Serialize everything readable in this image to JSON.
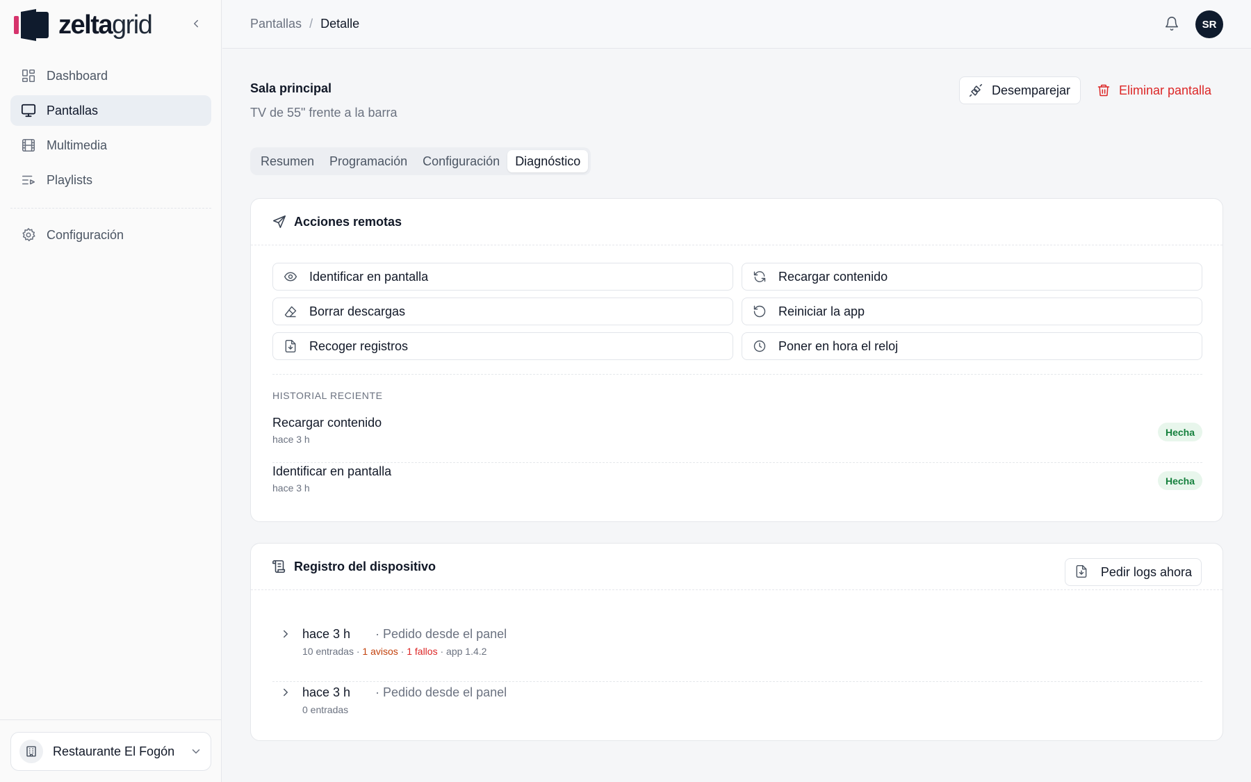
{
  "brand": {
    "name_bold": "zelta",
    "name_light": "grid",
    "accent": "#d6336c",
    "mark": "#0f1b2d"
  },
  "sidebar": {
    "items": [
      {
        "label": "Dashboard",
        "icon": "dashboard-icon"
      },
      {
        "label": "Pantallas",
        "icon": "monitor-icon",
        "active": true
      },
      {
        "label": "Multimedia",
        "icon": "film-icon"
      },
      {
        "label": "Playlists",
        "icon": "playlist-icon"
      }
    ],
    "settings": {
      "label": "Configuración",
      "icon": "gear-icon"
    },
    "org": {
      "name": "Restaurante El Fogón"
    }
  },
  "header": {
    "breadcrumb": {
      "parent": "Pantallas",
      "separator": "/",
      "current": "Detalle"
    },
    "avatar_initials": "SR"
  },
  "screen": {
    "title": "Sala principal",
    "subtitle": "TV de 55\" frente a la barra",
    "unpair_label": "Desemparejar",
    "delete_label": "Eliminar pantalla"
  },
  "tabs": [
    {
      "label": "Resumen"
    },
    {
      "label": "Programación"
    },
    {
      "label": "Configuración"
    },
    {
      "label": "Diagnóstico",
      "active": true
    }
  ],
  "remote_actions": {
    "title": "Acciones remotas",
    "actions": [
      {
        "label": "Identificar en pantalla",
        "icon": "eye-icon"
      },
      {
        "label": "Recargar contenido",
        "icon": "refresh-icon"
      },
      {
        "label": "Borrar descargas",
        "icon": "eraser-icon"
      },
      {
        "label": "Reiniciar la app",
        "icon": "restart-icon"
      },
      {
        "label": "Recoger registros",
        "icon": "file-download-icon"
      },
      {
        "label": "Poner en hora el reloj",
        "icon": "clock-icon"
      }
    ],
    "history_title": "HISTORIAL RECIENTE",
    "history": [
      {
        "action": "Recargar contenido",
        "time": "hace 3 h",
        "status": "Hecha"
      },
      {
        "action": "Identificar en pantalla",
        "time": "hace 3 h",
        "status": "Hecha"
      }
    ]
  },
  "device_log": {
    "title": "Registro del dispositivo",
    "request_label": "Pedir logs ahora",
    "entries": [
      {
        "time": "hace 3 h",
        "source": "· Pedido desde el panel",
        "entries_count": "10 entradas",
        "sep": " · ",
        "warnings": "1 avisos",
        "errors": "1 fallos",
        "app_version": "app 1.4.2"
      },
      {
        "time": "hace 3 h",
        "source": "· Pedido desde el panel",
        "entries_count": "0 entradas"
      }
    ]
  }
}
